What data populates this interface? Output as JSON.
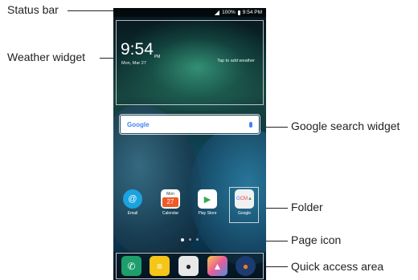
{
  "callouts": {
    "status_bar": "Status bar",
    "weather_widget": "Weather widget",
    "google_search_widget": "Google search widget",
    "folder": "Folder",
    "page_icon": "Page icon",
    "quick_access_area": "Quick access area"
  },
  "status_bar": {
    "battery": "100%",
    "time": "9:54 PM"
  },
  "weather": {
    "time": "9:54",
    "ampm": "PM",
    "date": "Mon, Mar 27",
    "tap_text": "Tap to add weather"
  },
  "search": {
    "logo": "Google",
    "icon": "mic-icon"
  },
  "apps": [
    {
      "label": "Email",
      "icon": "email-icon",
      "color": "#19a3e0"
    },
    {
      "label": "Calendar",
      "icon": "calendar-icon",
      "color": "#f05a28",
      "day": "Mon",
      "date": "27"
    },
    {
      "label": "Play Store",
      "icon": "play-store-icon",
      "color": "#ffffff"
    },
    {
      "label": "Google",
      "icon": "folder-icon",
      "color": "#f1f1f1"
    }
  ],
  "dock": [
    {
      "name": "phone",
      "icon": "phone-icon",
      "color": "#1e9e6a"
    },
    {
      "name": "messages",
      "icon": "message-icon",
      "color": "#f5c518"
    },
    {
      "name": "camera",
      "icon": "camera-icon",
      "color": "#e8e8e8"
    },
    {
      "name": "gallery",
      "icon": "gallery-icon",
      "color": "#e85c9a"
    },
    {
      "name": "firefox",
      "icon": "firefox-icon",
      "color": "#ff7a1a"
    }
  ],
  "page_indicator": {
    "pages": 3,
    "current": 1
  }
}
